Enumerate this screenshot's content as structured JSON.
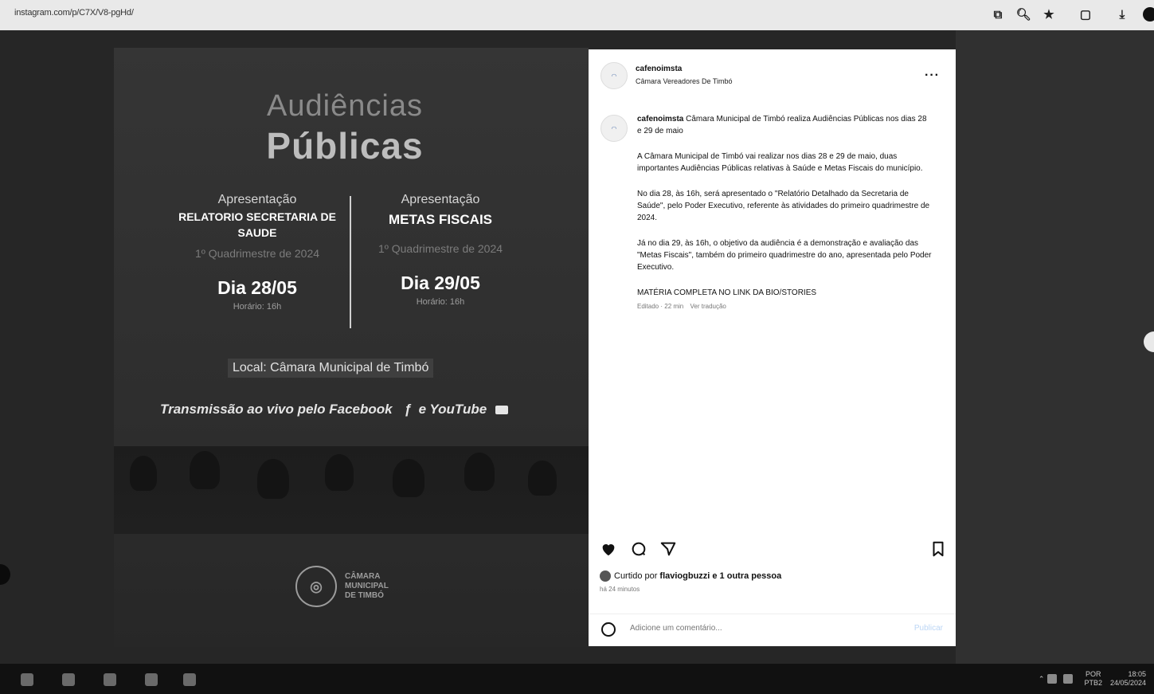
{
  "browser": {
    "url": "instagram.com/p/C7X/V8-pgHd/",
    "toolbar_icons": [
      "extension-icon",
      "zoom-icon",
      "star-icon",
      "extensions-puzzle-icon",
      "download-icon",
      "profile-dot-icon"
    ]
  },
  "poster": {
    "title_line1": "Audiências",
    "title_line2": "Públicas",
    "left": {
      "label": "Apresentação",
      "heading": "RELATORIO SECRETARIA DE SAUDE",
      "period": "1º Quadrimestre de 2024",
      "date": "Dia 28/05",
      "time": "Horário: 16h"
    },
    "right": {
      "label": "Apresentação",
      "heading": "METAS FISCAIS",
      "period": "1º Quadrimestre de 2024",
      "date": "Dia 29/05",
      "time": "Horário: 16h"
    },
    "local": "Local: Câmara Municipal de Timbó",
    "transmission": "Transmissão ao vivo pelo Facebook",
    "transmission_suffix": "e YouTube",
    "logo": [
      "CÂMARA",
      "MUNICIPAL",
      "DE TIMBÓ"
    ]
  },
  "instagram": {
    "username": "cafenoimsta",
    "subtitle": "Câmara Vereadores De Timbó",
    "caption": {
      "username": "cafenoimsta",
      "intro": "Câmara Municipal de Timbó realiza Audiências Públicas nos dias 28 e 29 de maio",
      "p1": "A Câmara Municipal de Timbó vai realizar nos dias 28 e 29 de maio, duas importantes Audiências Públicas relativas à Saúde e Metas Fiscais do município.",
      "p2": "No dia 28, às 16h, será apresentado o \"Relatório Detalhado da Secretaria de Saúde\", pelo Poder Executivo, referente às atividades do primeiro quadrimestre de 2024.",
      "p3": "Já no dia 29, às 16h, o objetivo da audiência é a demonstração e avaliação das \"Metas Fiscais\", também do primeiro quadrimestre do ano, apresentada pelo Poder Executivo.",
      "p4": "MATÉRIA COMPLETA NO LINK DA BIO/STORIES",
      "meta_edited": "Editado · 22 min",
      "meta_translate": "Ver tradução"
    },
    "likes_prefix": "Curtido por",
    "likes_user": "flaviogbuzzi",
    "likes_suffix": "e 1 outra pessoa",
    "posted": "há 24 minutos",
    "comment_placeholder": "Adicione um comentário...",
    "publish_label": "Publicar"
  },
  "taskbar": {
    "lang": "POR",
    "lang2": "PTB2",
    "time": "18:05",
    "date": "24/05/2024"
  },
  "colors": {
    "instagram_publish": "#bcd6f5",
    "backdrop": "#262626"
  }
}
